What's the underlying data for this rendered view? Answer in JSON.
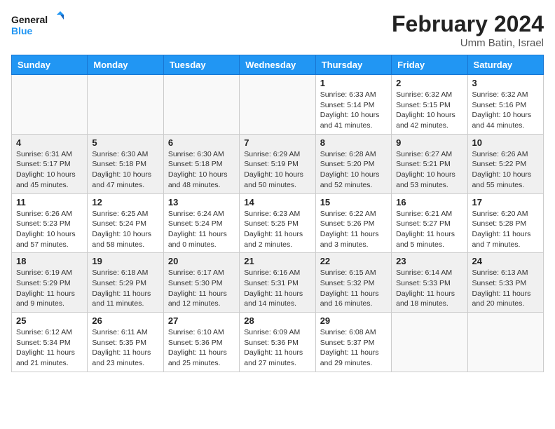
{
  "logo": {
    "line1": "General",
    "line2": "Blue"
  },
  "title": "February 2024",
  "subtitle": "Umm Batin, Israel",
  "days_of_week": [
    "Sunday",
    "Monday",
    "Tuesday",
    "Wednesday",
    "Thursday",
    "Friday",
    "Saturday"
  ],
  "weeks": [
    [
      {
        "day": "",
        "info": ""
      },
      {
        "day": "",
        "info": ""
      },
      {
        "day": "",
        "info": ""
      },
      {
        "day": "",
        "info": ""
      },
      {
        "day": "1",
        "info": "Sunrise: 6:33 AM\nSunset: 5:14 PM\nDaylight: 10 hours\nand 41 minutes."
      },
      {
        "day": "2",
        "info": "Sunrise: 6:32 AM\nSunset: 5:15 PM\nDaylight: 10 hours\nand 42 minutes."
      },
      {
        "day": "3",
        "info": "Sunrise: 6:32 AM\nSunset: 5:16 PM\nDaylight: 10 hours\nand 44 minutes."
      }
    ],
    [
      {
        "day": "4",
        "info": "Sunrise: 6:31 AM\nSunset: 5:17 PM\nDaylight: 10 hours\nand 45 minutes."
      },
      {
        "day": "5",
        "info": "Sunrise: 6:30 AM\nSunset: 5:18 PM\nDaylight: 10 hours\nand 47 minutes."
      },
      {
        "day": "6",
        "info": "Sunrise: 6:30 AM\nSunset: 5:18 PM\nDaylight: 10 hours\nand 48 minutes."
      },
      {
        "day": "7",
        "info": "Sunrise: 6:29 AM\nSunset: 5:19 PM\nDaylight: 10 hours\nand 50 minutes."
      },
      {
        "day": "8",
        "info": "Sunrise: 6:28 AM\nSunset: 5:20 PM\nDaylight: 10 hours\nand 52 minutes."
      },
      {
        "day": "9",
        "info": "Sunrise: 6:27 AM\nSunset: 5:21 PM\nDaylight: 10 hours\nand 53 minutes."
      },
      {
        "day": "10",
        "info": "Sunrise: 6:26 AM\nSunset: 5:22 PM\nDaylight: 10 hours\nand 55 minutes."
      }
    ],
    [
      {
        "day": "11",
        "info": "Sunrise: 6:26 AM\nSunset: 5:23 PM\nDaylight: 10 hours\nand 57 minutes."
      },
      {
        "day": "12",
        "info": "Sunrise: 6:25 AM\nSunset: 5:24 PM\nDaylight: 10 hours\nand 58 minutes."
      },
      {
        "day": "13",
        "info": "Sunrise: 6:24 AM\nSunset: 5:24 PM\nDaylight: 11 hours\nand 0 minutes."
      },
      {
        "day": "14",
        "info": "Sunrise: 6:23 AM\nSunset: 5:25 PM\nDaylight: 11 hours\nand 2 minutes."
      },
      {
        "day": "15",
        "info": "Sunrise: 6:22 AM\nSunset: 5:26 PM\nDaylight: 11 hours\nand 3 minutes."
      },
      {
        "day": "16",
        "info": "Sunrise: 6:21 AM\nSunset: 5:27 PM\nDaylight: 11 hours\nand 5 minutes."
      },
      {
        "day": "17",
        "info": "Sunrise: 6:20 AM\nSunset: 5:28 PM\nDaylight: 11 hours\nand 7 minutes."
      }
    ],
    [
      {
        "day": "18",
        "info": "Sunrise: 6:19 AM\nSunset: 5:29 PM\nDaylight: 11 hours\nand 9 minutes."
      },
      {
        "day": "19",
        "info": "Sunrise: 6:18 AM\nSunset: 5:29 PM\nDaylight: 11 hours\nand 11 minutes."
      },
      {
        "day": "20",
        "info": "Sunrise: 6:17 AM\nSunset: 5:30 PM\nDaylight: 11 hours\nand 12 minutes."
      },
      {
        "day": "21",
        "info": "Sunrise: 6:16 AM\nSunset: 5:31 PM\nDaylight: 11 hours\nand 14 minutes."
      },
      {
        "day": "22",
        "info": "Sunrise: 6:15 AM\nSunset: 5:32 PM\nDaylight: 11 hours\nand 16 minutes."
      },
      {
        "day": "23",
        "info": "Sunrise: 6:14 AM\nSunset: 5:33 PM\nDaylight: 11 hours\nand 18 minutes."
      },
      {
        "day": "24",
        "info": "Sunrise: 6:13 AM\nSunset: 5:33 PM\nDaylight: 11 hours\nand 20 minutes."
      }
    ],
    [
      {
        "day": "25",
        "info": "Sunrise: 6:12 AM\nSunset: 5:34 PM\nDaylight: 11 hours\nand 21 minutes."
      },
      {
        "day": "26",
        "info": "Sunrise: 6:11 AM\nSunset: 5:35 PM\nDaylight: 11 hours\nand 23 minutes."
      },
      {
        "day": "27",
        "info": "Sunrise: 6:10 AM\nSunset: 5:36 PM\nDaylight: 11 hours\nand 25 minutes."
      },
      {
        "day": "28",
        "info": "Sunrise: 6:09 AM\nSunset: 5:36 PM\nDaylight: 11 hours\nand 27 minutes."
      },
      {
        "day": "29",
        "info": "Sunrise: 6:08 AM\nSunset: 5:37 PM\nDaylight: 11 hours\nand 29 minutes."
      },
      {
        "day": "",
        "info": ""
      },
      {
        "day": "",
        "info": ""
      }
    ]
  ]
}
